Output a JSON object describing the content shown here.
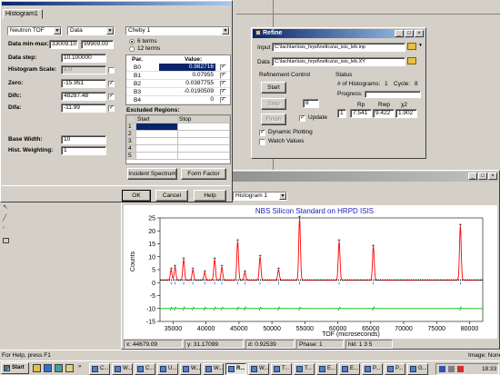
{
  "histogram": {
    "title": "Histogram1",
    "type_value": "Neutron TOF",
    "data_value": "Data",
    "minmax_label": "Data min-max:",
    "min_value": "33009.10",
    "max_value": "99909.00",
    "step_label": "Data step:",
    "step_value": "10.100000",
    "scale_label": "Histogram Scale:",
    "scale_value": "1.0",
    "zero_label": "Zero:",
    "zero_value": "-15.951",
    "difc_label": "Difc:",
    "difc_value": "48287.48",
    "difa_label": "Difa:",
    "difa_value": "-11.99",
    "basewidth_label": "Base Width:",
    "basewidth_value": "10",
    "weighting_label": "Hist. Weighting:",
    "weighting_value": "1",
    "cheby_value": "Cheby 1",
    "terms6_label": "6 terms",
    "terms12_label": "12 terms",
    "par_header": "Par.",
    "value_header": "Value:",
    "params": [
      {
        "name": "B0",
        "value": "0.982716"
      },
      {
        "name": "B1",
        "value": "0.07955"
      },
      {
        "name": "B2",
        "value": "0.0387755"
      },
      {
        "name": "B3",
        "value": "-0.0190509"
      },
      {
        "name": "B4",
        "value": "0"
      }
    ],
    "excluded_label": "Excluded Regions:",
    "start_header": "Start",
    "stop_header": "Stop",
    "row_numbers": [
      "1",
      "2",
      "3",
      "4",
      "5"
    ],
    "incident_button": "Incident Spectrum",
    "form_button": "Form Factor",
    "ok_button": "OK",
    "cancel_button": "Cancel",
    "help_button": "Help"
  },
  "refine": {
    "title": "Refine",
    "input_label": "Input",
    "input_path": "C:\\lachlan\\isis_hrpd\\netlca\\si_isis_leb.inp",
    "data_label": "Data",
    "data_path": "C:\\lachlan\\isis_hrpd\\netlca\\si_isis_leb.XY",
    "control_label": "Refinement Control",
    "start_button": "Start",
    "step_button": "Step",
    "finish_button": "Finish",
    "step_count": "8",
    "update_label": "Update",
    "dynamic_label": "Dynamic Plotting",
    "watch_label": "Watch Values",
    "status_label": "Status",
    "histograms_label": "# of Histograms:",
    "histograms_value": "1",
    "cycle_label": "Cycle:",
    "cycle_value": "8",
    "progress_label": "Progress:",
    "rp_label": "Rp",
    "rwp_label": "Rwp",
    "chi_label": "χ2",
    "rp_value": "7.541",
    "rwp_value": "9.422",
    "chi_value": "1.902"
  },
  "plotwin": {
    "selector": "Histogram 1",
    "status_x": "x: 44679.09",
    "status_y": "y: 31.17099",
    "status_d": "d: 0.92539",
    "status_phase": "Phase: 1",
    "status_hkl": "hkl: 1 3 5"
  },
  "chart_data": {
    "type": "line",
    "title": "NBS Silicon Standard on HRPD ISIS",
    "xlabel": "TOF (microseconds)",
    "ylabel": "Counts",
    "xlim": [
      33009,
      82000
    ],
    "ylim": [
      -15,
      25
    ],
    "xticks": [
      35000,
      40000,
      45000,
      50000,
      55000,
      60000,
      65000,
      70000,
      75000,
      80000
    ],
    "yticks": [
      -15,
      -10,
      -5,
      0,
      5,
      10,
      15,
      20,
      25
    ],
    "background_level": 1,
    "difference_offset": -10,
    "peaks": [
      {
        "x": 34700,
        "y": 5
      },
      {
        "x": 35300,
        "y": 6
      },
      {
        "x": 36600,
        "y": 9
      },
      {
        "x": 38000,
        "y": 5
      },
      {
        "x": 39800,
        "y": 4
      },
      {
        "x": 41300,
        "y": 9
      },
      {
        "x": 42400,
        "y": 6
      },
      {
        "x": 44800,
        "y": 16
      },
      {
        "x": 45900,
        "y": 4
      },
      {
        "x": 48200,
        "y": 10
      },
      {
        "x": 51000,
        "y": 5
      },
      {
        "x": 54200,
        "y": 25
      },
      {
        "x": 60200,
        "y": 16
      },
      {
        "x": 65400,
        "y": 14
      },
      {
        "x": 78600,
        "y": 22
      }
    ],
    "colors": {
      "observed": "#000000",
      "calculated": "#ff0000",
      "difference": "#00c000",
      "reflections": "#3060ff",
      "title": "#2020c0"
    }
  },
  "statusbar": {
    "help_text": "For Help, press F1",
    "image_text": "Image: None"
  },
  "taskbar": {
    "start_label": "Start",
    "items": [
      "C...",
      "W...",
      "C...",
      "U...",
      "W...",
      "W...",
      "R...",
      "W...",
      "T...",
      "T...",
      "E...",
      "E...",
      "P...",
      "P...",
      "G..."
    ],
    "clock": "18:33"
  }
}
